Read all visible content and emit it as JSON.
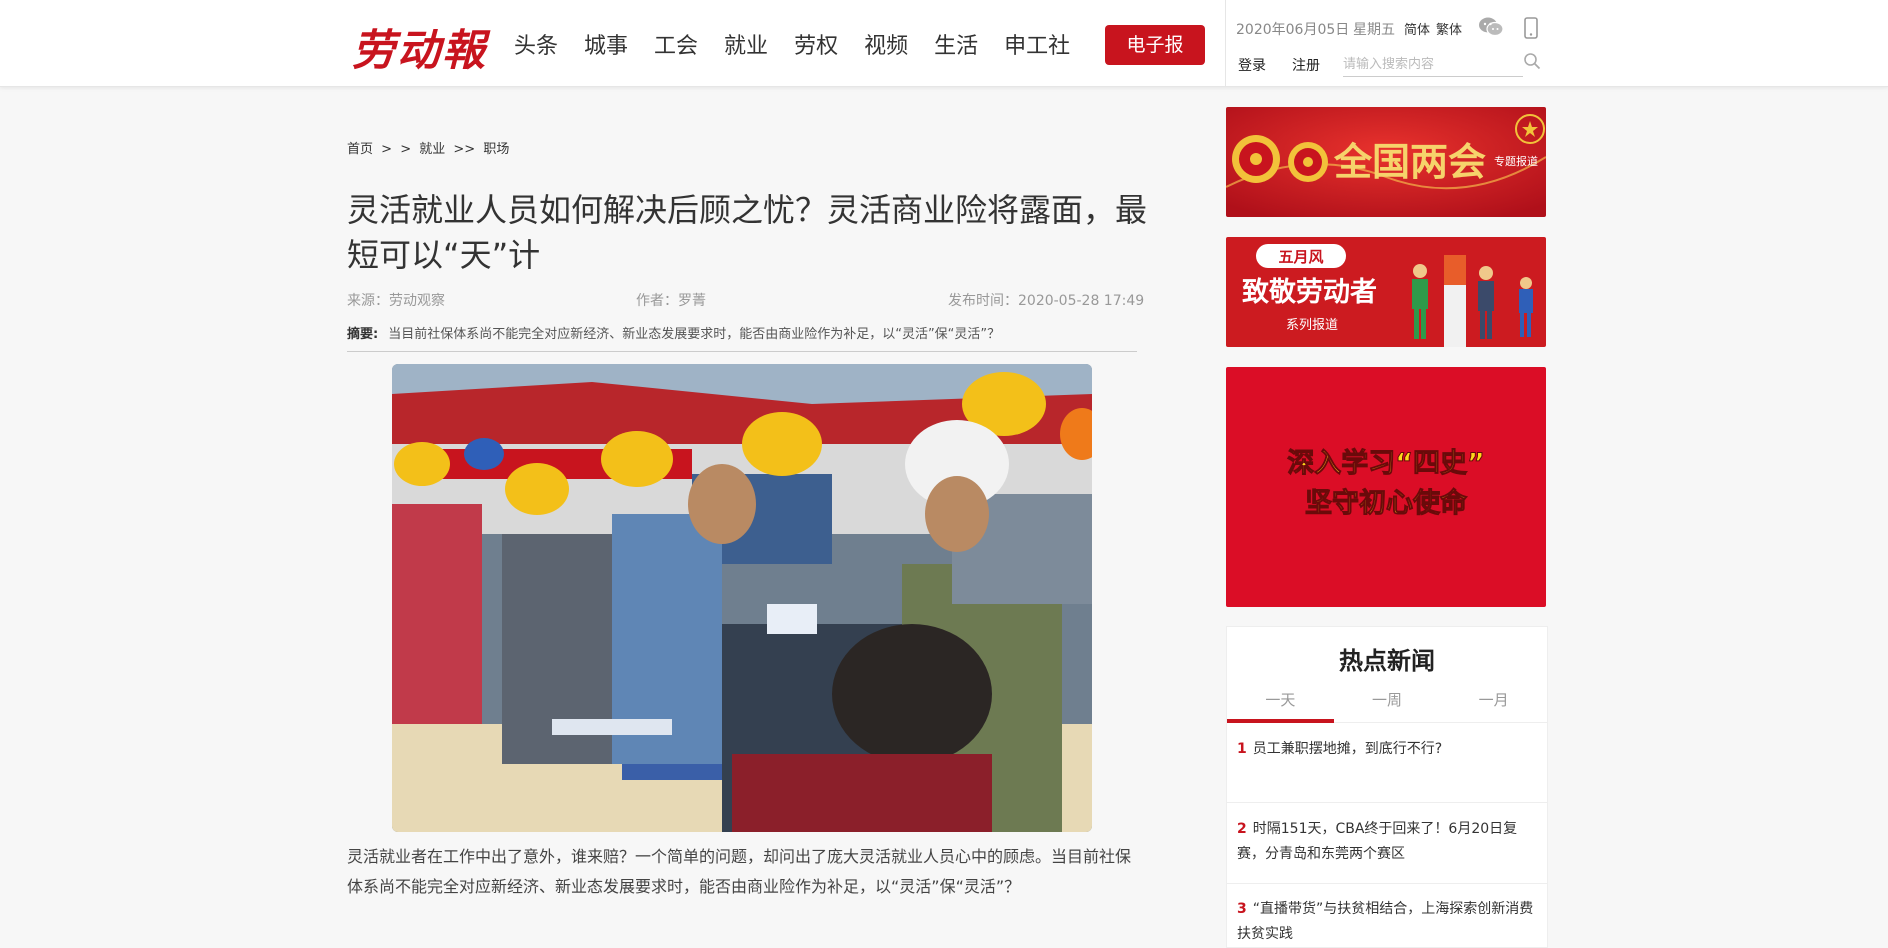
{
  "header": {
    "logo_text": "劳动報",
    "nav": [
      "头条",
      "城事",
      "工会",
      "就业",
      "劳权",
      "视频",
      "生活",
      "申工社"
    ],
    "epaper_label": "电子报",
    "date": "2020年06月05日",
    "weekday": "星期五",
    "lang_simplified": "简体",
    "lang_traditional": "繁体",
    "login_label": "登录",
    "register_label": "注册",
    "search_placeholder": "请输入搜索内容",
    "icons": [
      "wechat-icon",
      "mobile-icon",
      "search-icon"
    ]
  },
  "breadcrumb": {
    "home": "首页",
    "sep1": ">",
    "sep2": ">",
    "section": "就业",
    "sep3": ">>",
    "subsection": "职场"
  },
  "article": {
    "title": "灵活就业人员如何解决后顾之忧？灵活商业险将露面，最短可以“天”计",
    "source": "来源：劳动观察",
    "author": "作者：罗菁",
    "published": "发布时间：2020-05-28 17:49",
    "summary_label": "摘要:",
    "summary": "当目前社保体系尚不能完全对应新经济、新业态发展要求时，能否由商业险作为补足，以“灵活”保“灵活”？",
    "body_first_para": "灵活就业者在工作中出了意外，谁来赔？一个简单的问题，却问出了庞大灵活就业人员心中的顾虑。当目前社保体系尚不能完全对应新经济、新业态发展要求时，能否由商业险作为补足，以“灵活”保“灵活”？"
  },
  "sidebar": {
    "banner1": {
      "main": "全国两会",
      "tag": "专题报道"
    },
    "banner2": {
      "tag": "五月风",
      "main": "致敬劳动者",
      "sub": "系列报道"
    },
    "banner3": {
      "line1": "深入学习“四史”",
      "line2": "坚守初心使命"
    },
    "hot_news": {
      "title": "热点新闻",
      "tabs": [
        "一天",
        "一周",
        "一月"
      ],
      "active_tab": 0,
      "items": [
        {
          "num": "1",
          "text": "员工兼职摆地摊，到底行不行?"
        },
        {
          "num": "2",
          "text": "时隔151天，CBA终于回来了！6月20日复赛，分青岛和东莞两个赛区"
        },
        {
          "num": "3",
          "text": "“直播带货”与扶贫相结合，上海探索创新消费扶贫实践"
        }
      ]
    }
  },
  "colors": {
    "brand_red": "#c8141e",
    "background": "#f7f7f7"
  }
}
